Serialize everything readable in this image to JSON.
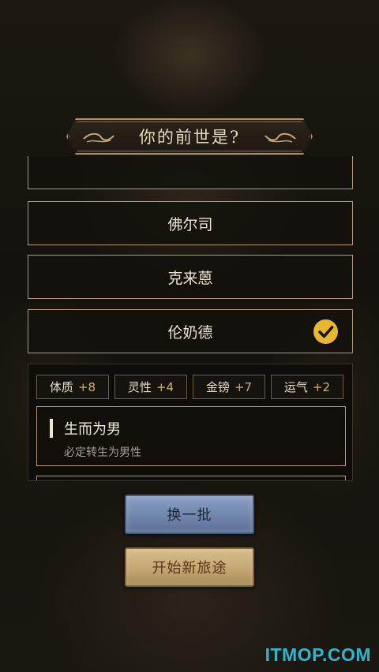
{
  "header": {
    "title": "你的前世是?"
  },
  "options": [
    {
      "label": ""
    },
    {
      "label": "佛尔司"
    },
    {
      "label": "克来蒽"
    },
    {
      "label": "伦奶德",
      "selected": true
    }
  ],
  "stats": [
    {
      "name": "体质",
      "value": "+8"
    },
    {
      "name": "灵性",
      "value": "+4"
    },
    {
      "name": "金镑",
      "value": "+7"
    },
    {
      "name": "运气",
      "value": "+2"
    }
  ],
  "traits": [
    {
      "name": "生而为男",
      "description": "必定转生为男性"
    }
  ],
  "buttons": {
    "refresh_label": "换一批",
    "start_label": "开始新旅途"
  },
  "watermark": "ITMOP.COM",
  "colors": {
    "accent_gold": "#e8b731",
    "stat_value": "#d9b15a",
    "border": "#b49a72"
  },
  "icons": {
    "selected": "check-circle-icon",
    "ornament": "swirl-ornament-icon"
  }
}
